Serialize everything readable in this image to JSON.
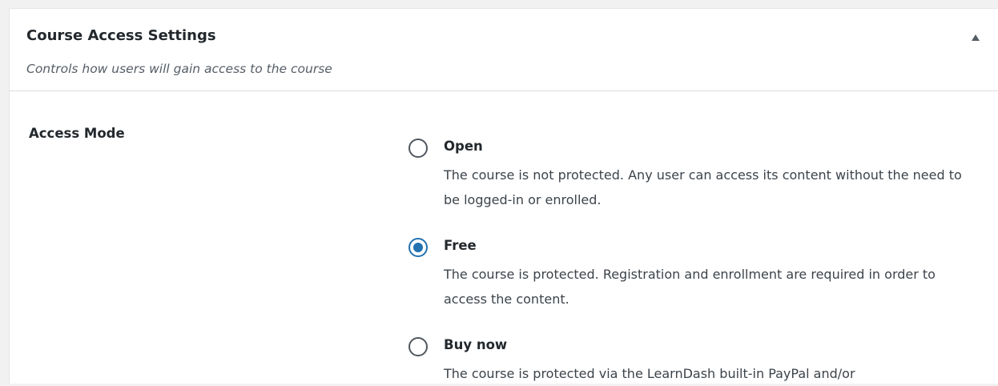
{
  "panel": {
    "title": "Course Access Settings",
    "subtitle": "Controls how users will gain access to the course",
    "toggle_icon": "triangle-up-icon"
  },
  "access_mode": {
    "label": "Access Mode",
    "selected": "Free",
    "accent_color": "#2271b1",
    "options": [
      {
        "title": "Open",
        "description": "The course is not protected. Any user can access its content without the need to be logged-in or enrolled.",
        "checked": false
      },
      {
        "title": "Free",
        "description": "The course is protected. Registration and enrollment are required in order to access the content.",
        "checked": true
      },
      {
        "title": "Buy now",
        "description": "The course is protected via the LearnDash built-in PayPal and/or",
        "checked": false
      }
    ]
  }
}
